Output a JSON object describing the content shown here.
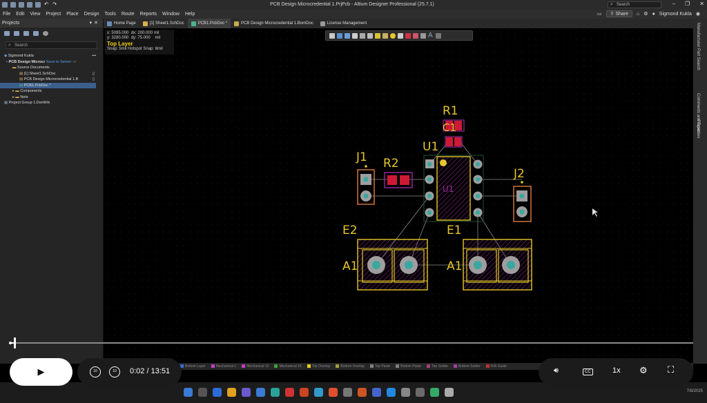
{
  "window": {
    "title": "PCB Design Microcredential 1.PrjPcb - Altium Designer Professional (25.7.1)",
    "search_placeholder": "Search"
  },
  "menu": {
    "items": [
      "File",
      "Edit",
      "View",
      "Project",
      "Place",
      "Design",
      "Tools",
      "Route",
      "Reports",
      "Window",
      "Help"
    ],
    "share_label": "Share",
    "user": "Sigmond Kukla"
  },
  "projects_panel": {
    "title": "Projects",
    "search_placeholder": "Search",
    "tree": {
      "workspace": "Sigmond Kukla",
      "project": "PCB Design Microcr",
      "save_to_server": "Save to Server",
      "source_documents": "Source Documents",
      "sheet": "[1] Sheet1.SchDoc",
      "bom": "PCB Design Microcredential 1.B",
      "pcb": "PCB1.PcbDoc *",
      "components": "Components",
      "nets": "Nets",
      "project_group": "Project Group 1.DsnWrk"
    }
  },
  "doc_tabs": [
    {
      "label": "Home Page",
      "color": "#6b8bb5"
    },
    {
      "label": "[1] Sheet1.SchDoc",
      "color": "#d6b04a"
    },
    {
      "label": "PCB1.PcbDoc *",
      "color": "#4db38a"
    },
    {
      "label": "PCB Design Microcredential 1.BomDoc",
      "color": "#c9a94a"
    },
    {
      "label": "License Management",
      "color": "#999999"
    }
  ],
  "coordinates": {
    "x_label": "x:",
    "x_val": "5095.000",
    "dx_label": "dx:",
    "dx_val": "200.000",
    "y_label": "y:",
    "y_val": "3280.000",
    "dy_label": "dy:",
    "dy_val": "75.000",
    "unit": "mil",
    "layer": "Top Layer",
    "snap": "Snap: 5mil Hotspot Snap: 8mil"
  },
  "right_rail": [
    "Manufacturer Part Search",
    "Comments and Tasks",
    "Properties"
  ],
  "designators": {
    "r1": "R1",
    "c1": "C1",
    "u1": "U1",
    "u1_body": "U1",
    "j1": "J1",
    "r2": "R2",
    "j2": "J2",
    "e2": "E2",
    "e1": "E1",
    "a1_left": "A1",
    "a1_right": "A1"
  },
  "layer_tabs": [
    {
      "label": "Bottom Layer",
      "color": "#3a6bd6"
    },
    {
      "label": "Mechanical 1",
      "color": "#c040c0"
    },
    {
      "label": "Mechanical 13",
      "color": "#c040c0"
    },
    {
      "label": "Mechanical 15",
      "color": "#40a040"
    },
    {
      "label": "Top Overlay",
      "color": "#e0d020"
    },
    {
      "label": "Bottom Overlay",
      "color": "#a0a040"
    },
    {
      "label": "Top Paste",
      "color": "#808080"
    },
    {
      "label": "Bottom Paste",
      "color": "#808080"
    },
    {
      "label": "Top Solder",
      "color": "#a04080"
    },
    {
      "label": "Bottom Solder",
      "color": "#a040a0"
    },
    {
      "label": "Drill Guide",
      "color": "#c03030"
    }
  ],
  "video": {
    "current_time": "0:02",
    "separator": "/",
    "duration": "13:51",
    "progress": 0.0024,
    "skip_back": "10",
    "skip_forward": "10",
    "speed": "1x",
    "cc_label": "CC"
  },
  "taskbar": {
    "icon_colors": [
      "#3a7bd5",
      "#555555",
      "#2d6bd8",
      "#e0a020",
      "#6a5acd",
      "#3a7bd5",
      "#2aa198",
      "#cc3333",
      "#cc4422",
      "#3399cc",
      "#e05030",
      "#777777",
      "#cc5522",
      "#4466cc",
      "#2288dd",
      "#888888",
      "#6a6a6a",
      "#33aa66",
      "#aaaaaa"
    ],
    "date": "7/8/2025"
  },
  "colors": {
    "copper_top": "#cc1a35",
    "overlay": "#e6c72a",
    "mechanical": "#9a2a9a",
    "pad_hole": "#3aa7a0",
    "ratsnest": "#9a9a9a"
  }
}
